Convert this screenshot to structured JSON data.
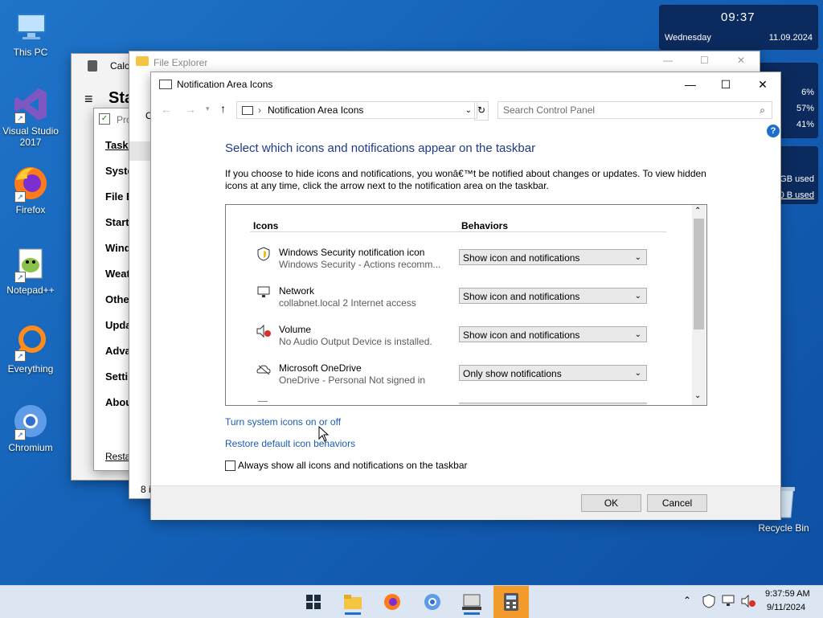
{
  "desktop": {
    "icons": [
      {
        "label": "This PC"
      },
      {
        "label": "Visual Studio 2017"
      },
      {
        "label": "Firefox"
      },
      {
        "label": "Notepad++"
      },
      {
        "label": "Everything"
      },
      {
        "label": "Chromium"
      },
      {
        "label": "Recycle Bin"
      }
    ]
  },
  "widgets": {
    "clock": {
      "time": "09:37",
      "day": "Wednesday",
      "date": "11.09.2024"
    },
    "usage": {
      "values": [
        "6%",
        "57%",
        "41%"
      ]
    },
    "disk": {
      "line1": "GB used",
      "line2": "0 B used"
    }
  },
  "bg_windows": {
    "calculator_title": "Calc",
    "settings_header": "Sta",
    "settings_items": [
      "Taskb",
      "Syste",
      "File E",
      "Start",
      "Wind",
      "Weat",
      "Othe",
      "Upda",
      "Adva",
      "Setti",
      "Abou"
    ],
    "settings_restart": "Restar",
    "properties_title": "Pro",
    "explorer_title": "File Explorer",
    "explorer_status": "8 i",
    "explorer_frag": "O"
  },
  "dialog": {
    "title": "Notification Area Icons",
    "address": "Notification Area Icons",
    "search_placeholder": "Search Control Panel",
    "heading": "Select which icons and notifications appear on the taskbar",
    "description": "If you choose to hide icons and notifications, you wonâ€™t be notified about changes or updates. To view hidden icons at any time, click the arrow next to the notification area on the taskbar.",
    "col_icons": "Icons",
    "col_behaviors": "Behaviors",
    "rows": [
      {
        "name": "Windows Security notification icon",
        "sub": "Windows Security - Actions recomm...",
        "behavior": "Show icon and notifications",
        "icon": "shield-icon"
      },
      {
        "name": "Network",
        "sub": "collabnet.local 2 Internet access",
        "behavior": "Show icon and notifications",
        "icon": "network-icon"
      },
      {
        "name": "Volume",
        "sub": "No Audio Output Device is installed.",
        "behavior": "Show icon and notifications",
        "icon": "volume-muted-icon"
      },
      {
        "name": "Microsoft OneDrive",
        "sub": "OneDrive - Personal Not signed in",
        "behavior": "Only show notifications",
        "icon": "onedrive-icon"
      }
    ],
    "link_system_icons": "Turn system icons on or off",
    "link_restore": "Restore default icon behaviors",
    "checkbox_label": "Always show all icons and notifications on the taskbar",
    "ok_label": "OK",
    "cancel_label": "Cancel"
  },
  "taskbar": {
    "time": "9:37:59 AM",
    "date": "9/11/2024"
  }
}
